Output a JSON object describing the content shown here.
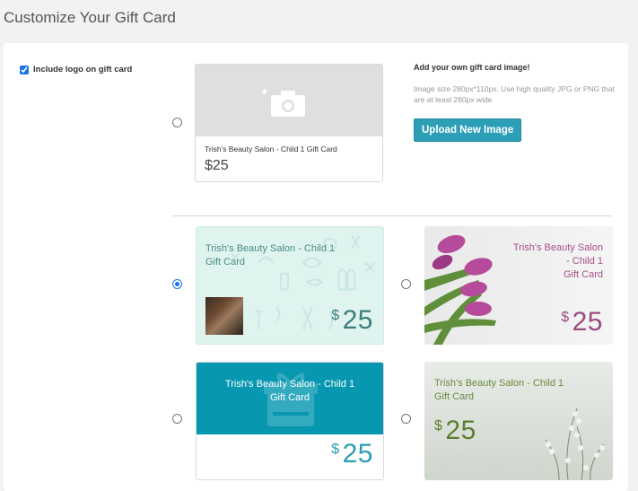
{
  "page": {
    "title": "Customize Your Gift Card"
  },
  "logo_option": {
    "label": "Include logo on gift card",
    "checked": true
  },
  "custom_card": {
    "name": "Trish's Beauty Salon - Child 1  Gift Card",
    "price": "$25",
    "selected": false
  },
  "upload": {
    "title": "Add your own gift card image!",
    "help": "Image size 280px*110px. Use high quality JPG or PNG that are at least 280px wide",
    "button_label": "Upload New Image"
  },
  "templates": [
    {
      "id": "salon-pattern",
      "line1": "Trish's Beauty Salon - Child 1",
      "line2": "Gift Card",
      "currency": "$",
      "amount": "25",
      "selected": true
    },
    {
      "id": "tulips",
      "line1": "Trish's Beauty Salon",
      "line2": "- Child 1",
      "line3": "Gift Card",
      "currency": "$",
      "amount": "25",
      "selected": false
    },
    {
      "id": "teal-gift",
      "line1": "Trish's Beauty Salon - Child 1",
      "line2": "Gift Card",
      "currency": "$",
      "amount": "25",
      "selected": false
    },
    {
      "id": "heather",
      "line1": "Trish's Beauty Salon - Child 1",
      "line2": "Gift Card",
      "currency": "$",
      "amount": "25",
      "selected": false
    }
  ],
  "colors": {
    "accent": "#2c9fb7",
    "radio_selected": "#1a73e8",
    "teal_band": "#0797b0",
    "tulip_text": "#a64f86",
    "heather_text": "#6b8a3f"
  }
}
